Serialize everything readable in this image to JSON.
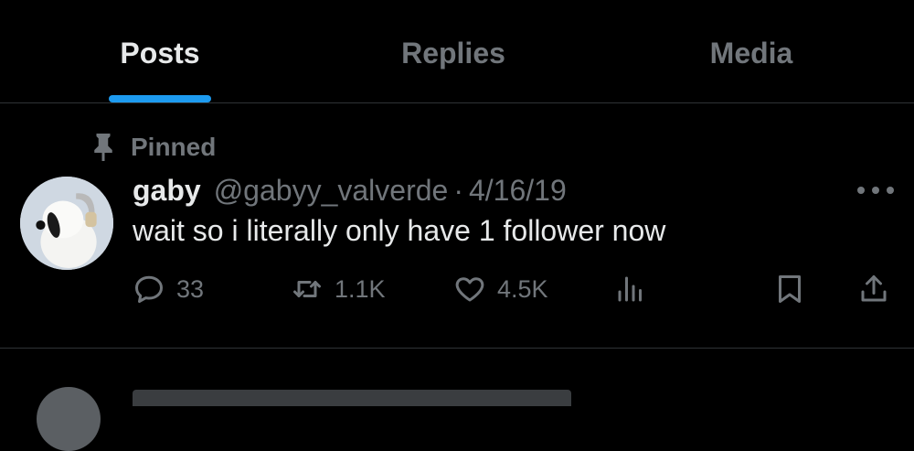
{
  "tabs": [
    {
      "label": "Posts",
      "active": true
    },
    {
      "label": "Replies",
      "active": false
    },
    {
      "label": "Media",
      "active": false
    }
  ],
  "colors": {
    "background": "#000000",
    "accent": "#1d9bf0",
    "primary_text": "#e7e9ea",
    "secondary_text": "#71767b",
    "border": "#2f3336"
  },
  "post": {
    "pinned_label": "Pinned",
    "author_name": "gaby",
    "author_handle": "@gabyy_valverde",
    "separator": "·",
    "date": "4/16/19",
    "text": "wait so i literally only have 1 follower now",
    "actions": {
      "reply_count": "33",
      "repost_count": "1.1K",
      "like_count": "4.5K"
    },
    "icons": [
      "pin-icon",
      "more-icon",
      "reply-icon",
      "repost-icon",
      "like-icon",
      "views-icon",
      "bookmark-icon",
      "share-icon"
    ]
  }
}
